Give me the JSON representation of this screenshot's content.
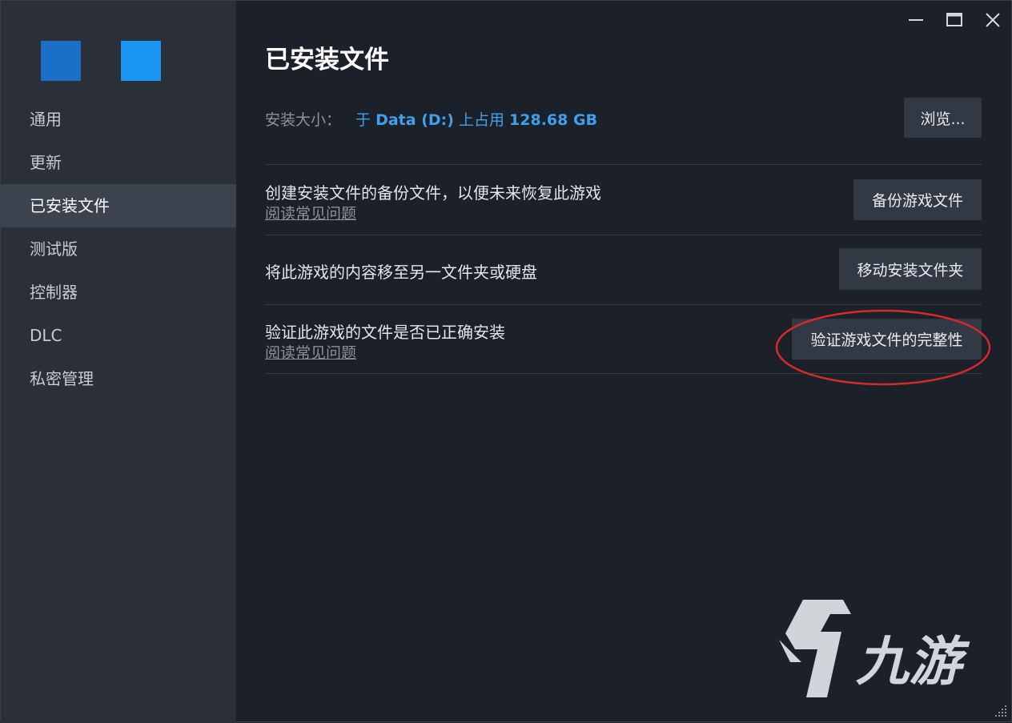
{
  "window_controls": {
    "minimize": "minimize-icon",
    "maximize": "maximize-icon",
    "close": "close-icon"
  },
  "sidebar": {
    "logo_colors": [
      "#1a6fc6",
      "#1b95f2"
    ],
    "items": [
      {
        "label": "通用",
        "active": false
      },
      {
        "label": "更新",
        "active": false
      },
      {
        "label": "已安装文件",
        "active": true
      },
      {
        "label": "测试版",
        "active": false
      },
      {
        "label": "控制器",
        "active": false
      },
      {
        "label": "DLC",
        "active": false
      },
      {
        "label": "私密管理",
        "active": false
      }
    ]
  },
  "main": {
    "title": "已安装文件",
    "install_size": {
      "label": "安装大小：",
      "prefix": "于",
      "drive": "Data (D:)",
      "mid": "上占用",
      "size": "128.68 GB",
      "browse_label": "浏览..."
    },
    "rows": [
      {
        "text": "创建安装文件的备份文件，以便未来恢复此游戏",
        "link": "阅读常见问题",
        "button": "备份游戏文件"
      },
      {
        "text": "将此游戏的内容移至另一文件夹或硬盘",
        "button": "移动安装文件夹"
      },
      {
        "text": "验证此游戏的文件是否已正确安装",
        "link": "阅读常见问题",
        "button": "验证游戏文件的完整性"
      }
    ]
  },
  "watermark": {
    "text": "九游"
  },
  "colors": {
    "background": "#1b2029",
    "sidebar": "#2a2f38",
    "sidebar_active": "#3c434e",
    "accent_blue": "#3fa0ec",
    "button": "#323844",
    "highlight_red": "#d42a2a"
  }
}
